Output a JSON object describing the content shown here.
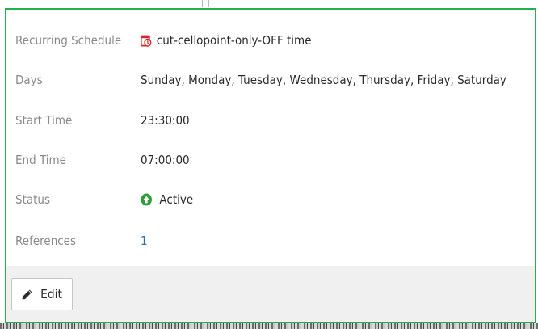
{
  "details": {
    "schedule": {
      "label": "Recurring Schedule",
      "value": "cut-cellopoint-only-OFF time",
      "icon": "recurring-schedule-icon",
      "icon_color": "#d9262b"
    },
    "days": {
      "label": "Days",
      "value": "Sunday, Monday, Tuesday, Wednesday, Thursday, Friday, Saturday"
    },
    "start_time": {
      "label": "Start Time",
      "value": "23:30:00"
    },
    "end_time": {
      "label": "End Time",
      "value": "07:00:00"
    },
    "status": {
      "label": "Status",
      "value": "Active",
      "icon": "active-arrow-up-icon",
      "icon_color": "#2e9d3a"
    },
    "references": {
      "label": "References",
      "value": "1"
    }
  },
  "actions": {
    "edit_label": "Edit",
    "edit_icon": "pencil-icon"
  },
  "colors": {
    "border": "#23b14d",
    "link": "#2f6ea5",
    "label": "#8a8a8a",
    "footer_bg": "#f0f0f0"
  }
}
